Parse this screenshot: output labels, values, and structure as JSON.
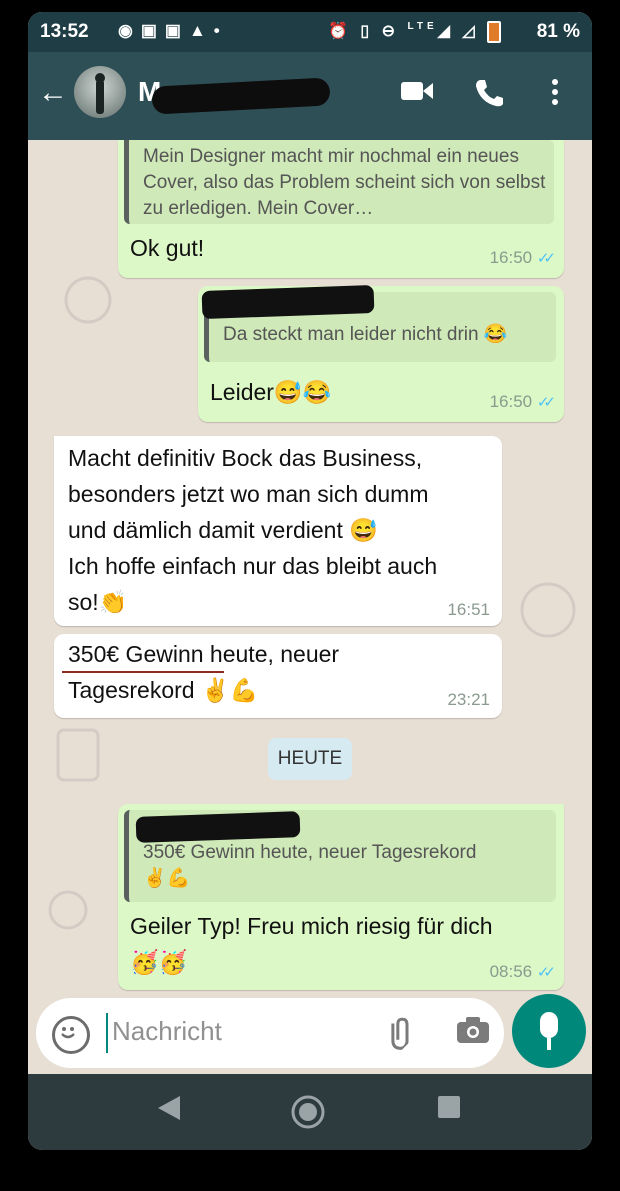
{
  "status_bar": {
    "time": "13:52",
    "left_icons": [
      "spotify-icon",
      "phone-cert-icon",
      "phone-cert-icon",
      "warning-icon",
      "dot-icon"
    ],
    "right_icons": [
      "alarm-icon",
      "vibrate-icon",
      "dnd-icon",
      "lte-signal-icon",
      "signal-icon",
      "battery-icon"
    ],
    "network": "LTE",
    "battery": "81 %"
  },
  "app_bar": {
    "contact_initial": "M",
    "icons": [
      "back-arrow-icon",
      "video-call-icon",
      "phone-call-icon",
      "more-vert-icon"
    ]
  },
  "messages": [
    {
      "direction": "outgoing",
      "quote": "Mein Designer macht mir nochmal ein neues Cover, also das Problem scheint sich von selbst zu erledigen. Mein Cover…",
      "text": "Ok gut!",
      "time": "16:50",
      "status": "read"
    },
    {
      "direction": "outgoing",
      "quote_author": "M",
      "quote": "Da steckt man leider nicht drin 😂",
      "text": "Leider😅😂",
      "time": "16:50",
      "status": "read"
    },
    {
      "direction": "incoming",
      "lines": [
        "Macht definitiv Bock das Business,",
        "besonders jetzt wo man sich dumm",
        "und dämlich damit verdient 😅",
        "Ich hoffe einfach nur das bleibt auch",
        "so!👏"
      ],
      "time": "16:51"
    },
    {
      "direction": "incoming",
      "lines": [
        "350€ Gewinn heute, neuer",
        "Tagesrekord ✌💪"
      ],
      "time": "23:21"
    },
    {
      "direction": "outgoing",
      "quote": "350€ Gewinn heute, neuer Tagesrekord",
      "quote_emoji": "✌💪",
      "text": "Geiler Typ! Freu mich riesig für dich",
      "text_emoji": "🥳🥳",
      "time": "08:56",
      "status": "read"
    }
  ],
  "day_separator": "HEUTE",
  "composer": {
    "placeholder": "Nachricht",
    "icons": [
      "emoji-icon",
      "attach-icon",
      "camera-icon",
      "mic-icon"
    ]
  },
  "nav_bar": {
    "icons": [
      "back-triangle-icon",
      "home-circle-icon",
      "recents-square-icon"
    ]
  },
  "colors": {
    "app_bar": "#2f4f57",
    "status_bar": "#1f3d45",
    "outgoing_bubble": "#dcf8c6",
    "incoming_bubble": "#ffffff",
    "chat_background": "#e7ded4",
    "accent": "#00897b",
    "read_ticks": "#4fc3f7"
  }
}
